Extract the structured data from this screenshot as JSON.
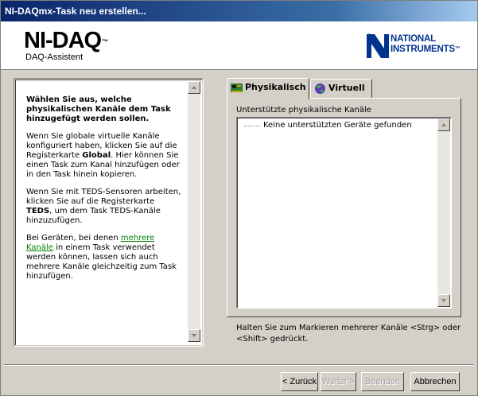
{
  "window": {
    "title": "NI-DAQmx-Task neu erstellen..."
  },
  "header": {
    "product": "NI-DAQ",
    "trademark": "™",
    "subtitle": "DAQ-Assistent",
    "brand_line1": "NATIONAL",
    "brand_line2": "INSTRUMENTS",
    "brand_tm": "™"
  },
  "help": {
    "lead": "Wählen Sie aus, welche physikalischen Kanäle dem Task hinzugefügt werden sollen.",
    "p1_a": "Wenn Sie globale virtuelle Kanäle konfiguriert haben, klicken Sie auf die Registerkarte ",
    "p1_bold": "Global",
    "p1_b": ". Hier können Sie einen Task zum Kanal hinzufügen oder in den Task hinein kopieren.",
    "p2_a": "Wenn Sie mit TEDS-Sensoren arbeiten, klicken Sie auf die Registerkarte ",
    "p2_bold": "TEDS",
    "p2_b": ", um dem Task TEDS-Kanäle hinzuzufügen.",
    "p3_a": "Bei Geräten, bei denen ",
    "p3_link": "mehrere Kanäle",
    "p3_b": " in einem Task verwendet werden können, lassen sich auch mehrere Kanäle gleichzeitig zum Task hinzufügen."
  },
  "tabs": [
    {
      "label": "Physikalisch",
      "icon": "daq-board-icon",
      "active": true
    },
    {
      "label": "Virtuell",
      "icon": "globe-icon",
      "active": false
    }
  ],
  "panel": {
    "label": "Unterstützte physikalische Kanäle",
    "tree_items": [
      "Keine unterstützten Geräte gefunden"
    ]
  },
  "hint": "Halten Sie zum Markieren mehrerer Kanäle <Strg> oder <Shift> gedrückt.",
  "buttons": {
    "back": "< Zurück",
    "next": "Weiter >",
    "finish": "Beenden",
    "cancel": "Abbrechen"
  },
  "colors": {
    "titlebar_start": "#0a246a",
    "titlebar_end": "#a6caf0",
    "ni_blue": "#00338d",
    "link_green": "#008000",
    "face": "#d4d0c8"
  }
}
